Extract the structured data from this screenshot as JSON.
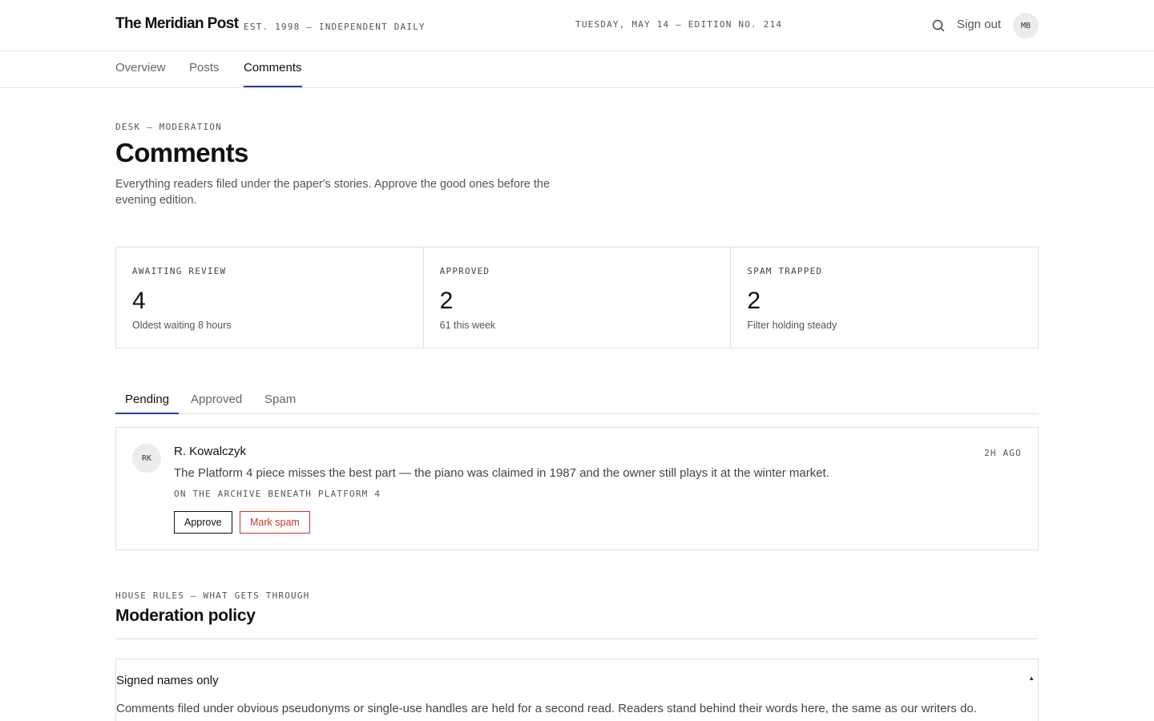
{
  "header": {
    "brand": "The Meridian Post",
    "tagline": "EST. 1998 — INDEPENDENT DAILY",
    "dateline": "TUESDAY, MAY 14 — EDITION NO. 214",
    "search_icon": "search-icon",
    "signout_label": "Sign out",
    "user_initials": "MB"
  },
  "nav": {
    "items": [
      {
        "label": "Overview"
      },
      {
        "label": "Posts"
      },
      {
        "label": "Comments"
      }
    ],
    "active": "Comments"
  },
  "page": {
    "kicker": "DESK — MODERATION",
    "title": "Comments",
    "description": "Everything readers filed under the paper's stories. Approve the good ones before the evening edition."
  },
  "stats": [
    {
      "label": "AWAITING REVIEW",
      "value": "4",
      "note": "Oldest waiting 8 hours"
    },
    {
      "label": "APPROVED",
      "value": "2",
      "note": "61 this week"
    },
    {
      "label": "SPAM TRAPPED",
      "value": "2",
      "note": "Filter holding steady"
    }
  ],
  "subtabs": {
    "items": [
      {
        "label": "Pending"
      },
      {
        "label": "Approved"
      },
      {
        "label": "Spam"
      }
    ],
    "active": "Pending"
  },
  "comments": [
    {
      "initials": "RK",
      "author": "R. Kowalczyk",
      "time": "2H AGO",
      "body": "The Platform 4 piece misses the best part — the piano was claimed in 1987 and the owner still plays it at the winter market.",
      "story": "ON THE ARCHIVE BENEATH PLATFORM 4",
      "approve_label": "Approve",
      "spam_label": "Mark spam"
    }
  ],
  "policy": {
    "kicker": "HOUSE RULES — WHAT GETS THROUGH",
    "title": "Moderation policy",
    "rules": [
      {
        "title": "Signed names only",
        "caret": "▲",
        "body": "Comments filed under obvious pseudonyms or single-use handles are held for a second read. Readers stand behind their words here, the same as our writers do."
      }
    ]
  },
  "colors": {
    "accent": "#2b3aa3",
    "danger": "#c0392b",
    "border": "#e0e0e0",
    "text": "#111111",
    "muted": "#555555"
  }
}
